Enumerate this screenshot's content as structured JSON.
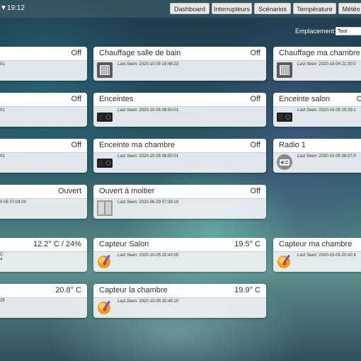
{
  "header": {
    "time": "▼19:12",
    "nav": [
      "Dashboard",
      "Interrupteurs",
      "Scénarios",
      "Température",
      "Météo"
    ]
  },
  "location": {
    "label": "Emplacement:",
    "selected": "Tout"
  },
  "seen_prefix": "Last Seen:",
  "cards": [
    {
      "name": "",
      "state": "Off",
      "seen": "01",
      "icon": ""
    },
    {
      "name": "Chauffage salle de bain",
      "state": "Off",
      "seen": "2020-10-05 19:48:23",
      "icon": "radiator-icon"
    },
    {
      "name": "Chauffage ma chambre",
      "state": "",
      "seen": "2020-10-04 21:30:0",
      "icon": "radiator-icon"
    },
    {
      "name": "",
      "state": "Off",
      "seen": "01",
      "icon": ""
    },
    {
      "name": "Enceintes",
      "state": "Off",
      "seen": "2020-10-05 08:50:01",
      "icon": "speaker-icon"
    },
    {
      "name": "Enceinte salon",
      "state": "Off",
      "seen": "2020-10-05 19:29:1",
      "icon": "speaker-icon"
    },
    {
      "name": "",
      "state": "Off",
      "seen": "01",
      "icon": ""
    },
    {
      "name": "Enceinte ma chambre",
      "state": "Off",
      "seen": "2020-10-05 08:50:01",
      "icon": "speaker-icon"
    },
    {
      "name": "Radio 1",
      "state": "",
      "seen": "2020-10-05 08:07:0",
      "icon": "radio-icon"
    },
    {
      "name": "",
      "state": "Ouvert",
      "seen": "0-05 07:04:00",
      "icon": ""
    },
    {
      "name": "Ouvert à moitier",
      "state": "Off",
      "seen": "2020-06-29 07:39:19",
      "icon": "door-icon"
    },
    {
      "name": "",
      "state": "12.2° C / 24%",
      "seen": "",
      "extra": [
        "C",
        "4"
      ],
      "icon": ""
    },
    {
      "name": "Capteur Salon",
      "state": "19.5° C",
      "seen": "2020-10-05 20:43:55",
      "icon": "thermometer-icon"
    },
    {
      "name": "Capteur ma chambre",
      "state": "",
      "seen": "2020-10-05 20:42:4",
      "icon": "thermometer-icon"
    },
    {
      "name": "",
      "state": "20.8° C",
      "seen": "",
      "extra": [
        "25"
      ],
      "icon": ""
    },
    {
      "name": "Capteur la chambre",
      "state": "19.9° C",
      "seen": "2020-10-05 20:45:10",
      "icon": "thermometer-icon"
    }
  ]
}
